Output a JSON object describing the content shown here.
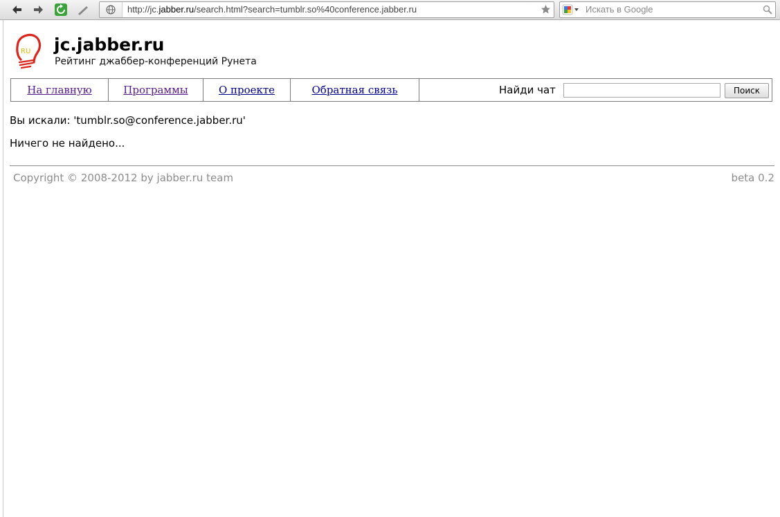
{
  "browser": {
    "url_prefix": "http://jc.",
    "url_domain": "jabber.ru",
    "url_rest": "/search.html?search=tumblr.so%40conference.jabber.ru",
    "search_placeholder": "Искать в Google",
    "icons": [
      "back-arrow-icon",
      "forward-arrow-icon",
      "reload-icon",
      "pen-icon",
      "globe-icon",
      "star-icon",
      "google-icon",
      "magnifier-icon"
    ]
  },
  "site": {
    "title": "jc.jabber.ru",
    "subtitle": "Рейтинг джаббер-конференций Рунета",
    "logo_text": "RU"
  },
  "nav": {
    "items": [
      {
        "label": "На главную"
      },
      {
        "label": "Программы"
      },
      {
        "label": "О проекте"
      },
      {
        "label": "Обратная связь"
      }
    ],
    "search_label": "Найди чат",
    "search_value": "",
    "search_button": "Поиск"
  },
  "results": {
    "query_line": "Вы искали: 'tumblr.so@conference.jabber.ru'",
    "message": "Ничего не найдено..."
  },
  "footer": {
    "copyright": "Copyright © 2008-2012 by jabber.ru team",
    "version": "beta 0.2"
  },
  "colors": {
    "link_visited": "#551a8b",
    "link": "#00008b",
    "footer_text": "#8c8c8c",
    "logo_red": "#d9261c",
    "logo_yellow": "#e8b500"
  }
}
